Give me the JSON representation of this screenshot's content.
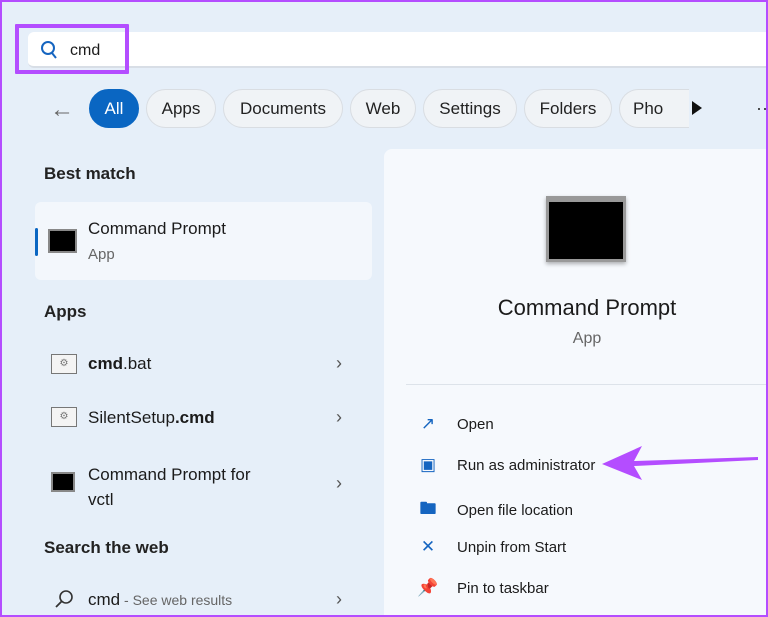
{
  "search": {
    "query": "cmd"
  },
  "filters": [
    "All",
    "Apps",
    "Documents",
    "Web",
    "Settings",
    "Folders",
    "Pho"
  ],
  "sections": {
    "best": "Best match",
    "apps": "Apps",
    "web": "Search the web"
  },
  "best_match": {
    "title": "Command Prompt",
    "type": "App"
  },
  "apps": [
    {
      "bold": "cmd",
      "rest": ".bat"
    },
    {
      "rest": "SilentSetup",
      "bold": ".cmd"
    },
    {
      "line1": "Command Prompt for",
      "line2": "vctl"
    }
  ],
  "web": {
    "query": "cmd",
    "suffix": " - See web results"
  },
  "detail": {
    "title": "Command Prompt",
    "type": "App"
  },
  "actions": [
    "Open",
    "Run as administrator",
    "Open file location",
    "Unpin from Start",
    "Pin to taskbar"
  ],
  "colors": {
    "accent": "#0a66c2",
    "highlight": "#b44dff"
  }
}
